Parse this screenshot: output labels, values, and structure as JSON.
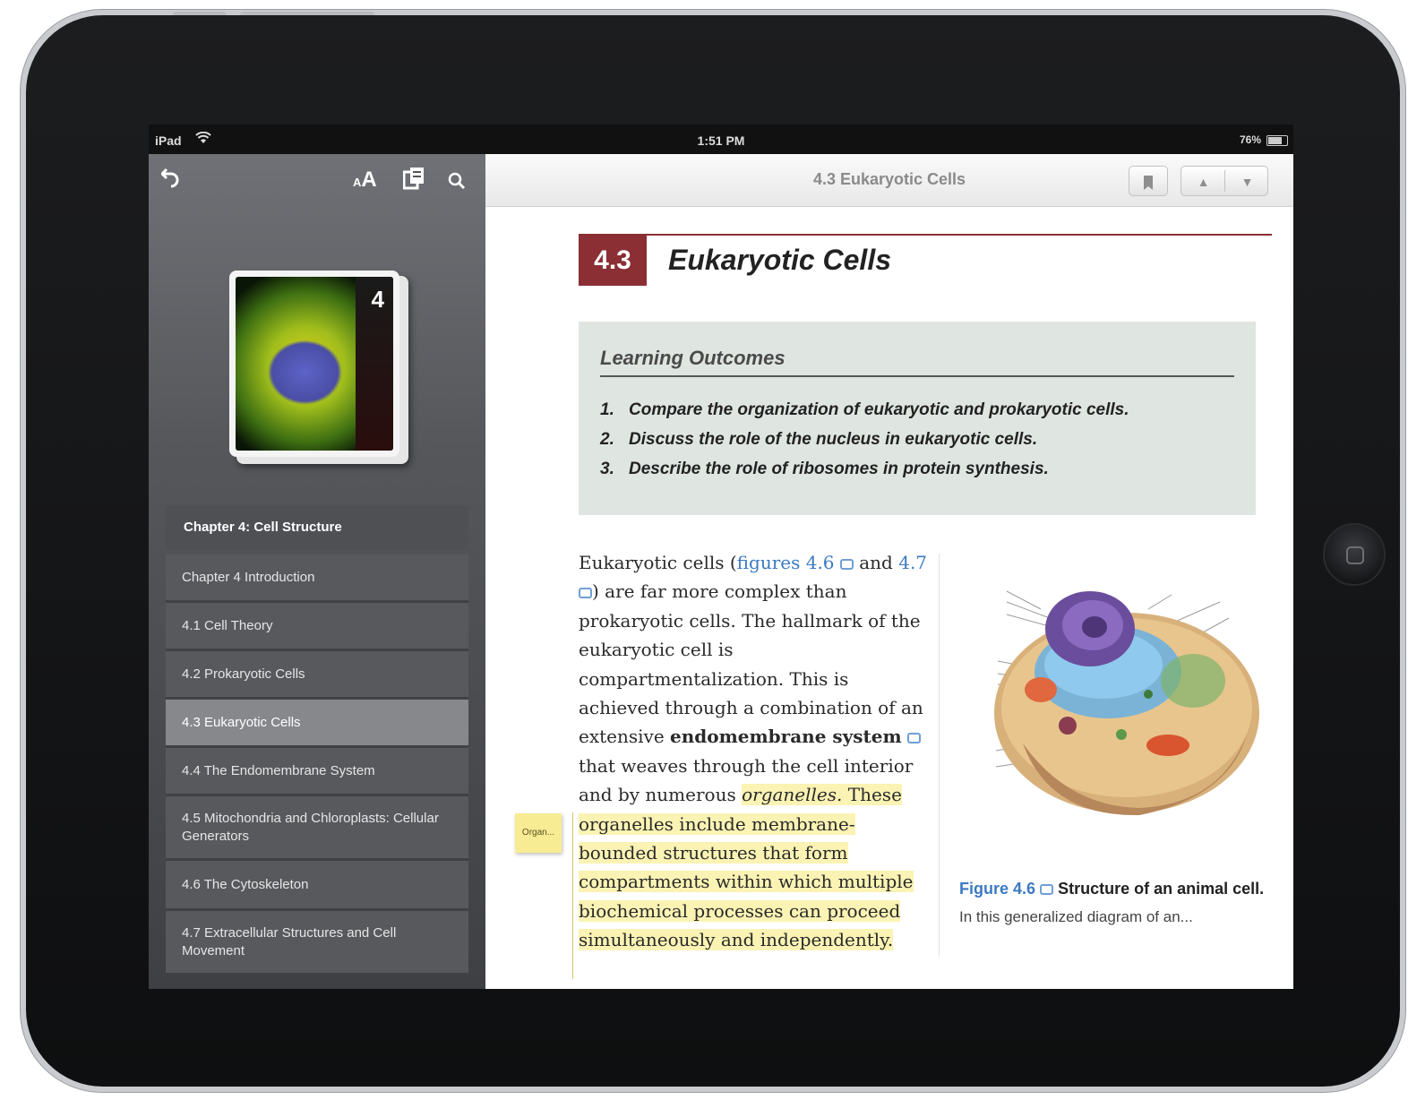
{
  "status_bar": {
    "carrier": "iPad",
    "time": "1:51 PM",
    "battery": "76%",
    "battery_level": 0.76
  },
  "sidebar": {
    "cover_number": "4",
    "chapter_title": "Chapter 4: Cell Structure",
    "toc": [
      {
        "label": "Chapter 4 Introduction",
        "active": false
      },
      {
        "label": "4.1 Cell Theory",
        "active": false
      },
      {
        "label": "4.2 Prokaryotic Cells",
        "active": false
      },
      {
        "label": "4.3 Eukaryotic Cells",
        "active": true
      },
      {
        "label": "4.4 The Endomembrane System",
        "active": false
      },
      {
        "label": "4.5 Mitochondria and Chloroplasts: Cellular Generators",
        "active": false
      },
      {
        "label": "4.6 The Cytoskeleton",
        "active": false
      },
      {
        "label": "4.7 Extracellular Structures and Cell Movement",
        "active": false
      }
    ],
    "tools": {
      "back_icon": "back-arrow-icon",
      "font_size_label": "AA",
      "toc_icon": "glossary-icon",
      "search_icon": "search-icon"
    }
  },
  "reader": {
    "nav_title": "4.3 Eukaryotic Cells",
    "prev_glyph": "▲",
    "next_glyph": "▼",
    "section_number": "4.3",
    "section_title": "Eukaryotic Cells",
    "learning_outcomes": {
      "title": "Learning Outcomes",
      "items": [
        {
          "num": "1.",
          "text": "Compare the organization of eukaryotic and prokaryotic cells."
        },
        {
          "num": "2.",
          "text": "Discuss the role of the nucleus in eukaryotic cells."
        },
        {
          "num": "3.",
          "text": "Describe the role of ribosomes in protein synthesis."
        }
      ]
    },
    "body": {
      "t1": "Eukaryotic cells (",
      "link1": "figures 4.6",
      "t2": " and",
      "link2": "4.7",
      "t3": ") are far more complex than prokaryotic cells. The hallmark of the eukaryotic cell is compartmentalization. This is achieved through a combination of an extensive ",
      "bold1": "endomembrane system",
      "t4": " that weaves through the cell interior and by numerous ",
      "hl_italic": "organelles.",
      "hl_text": " These organelles include membrane-bounded structures that form compartments within which multiple biochemical processes can proceed simultaneously and independently."
    },
    "sticky_note": "Organ...",
    "figure": {
      "label": "Figure 4.6",
      "title": "Structure of an animal cell.",
      "description": "In this generalized diagram of an..."
    }
  }
}
